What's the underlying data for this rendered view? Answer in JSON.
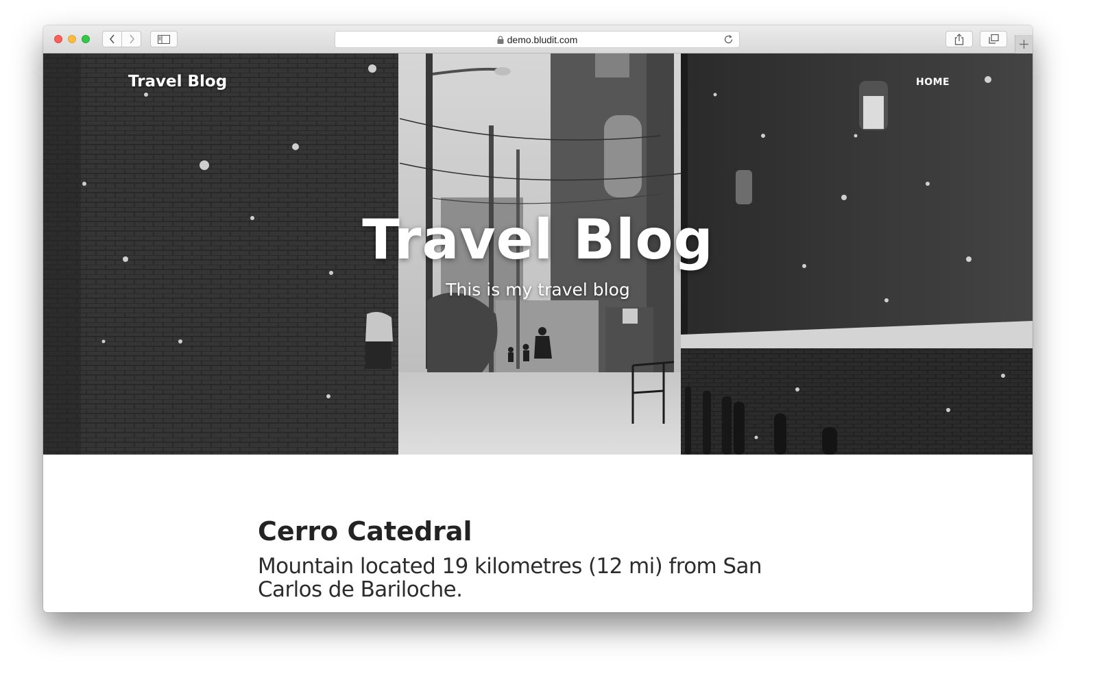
{
  "browser": {
    "url": "demo.bludit.com"
  },
  "site": {
    "brand": "Travel Blog",
    "nav": [
      {
        "label": "HOME"
      }
    ]
  },
  "hero": {
    "title": "Travel Blog",
    "subtitle": "This is my travel blog"
  },
  "post": {
    "title": "Cerro Catedral",
    "description": "Mountain located 19 kilometres (12 mi) from San Carlos de Bariloche."
  },
  "colors": {
    "close": "#fc605b",
    "minimize": "#fdbc40",
    "zoom": "#34c84a"
  },
  "icons": [
    "back-icon",
    "forward-icon",
    "sidebar-icon",
    "lock-icon",
    "reload-icon",
    "share-icon",
    "tabs-icon",
    "plus-icon"
  ]
}
